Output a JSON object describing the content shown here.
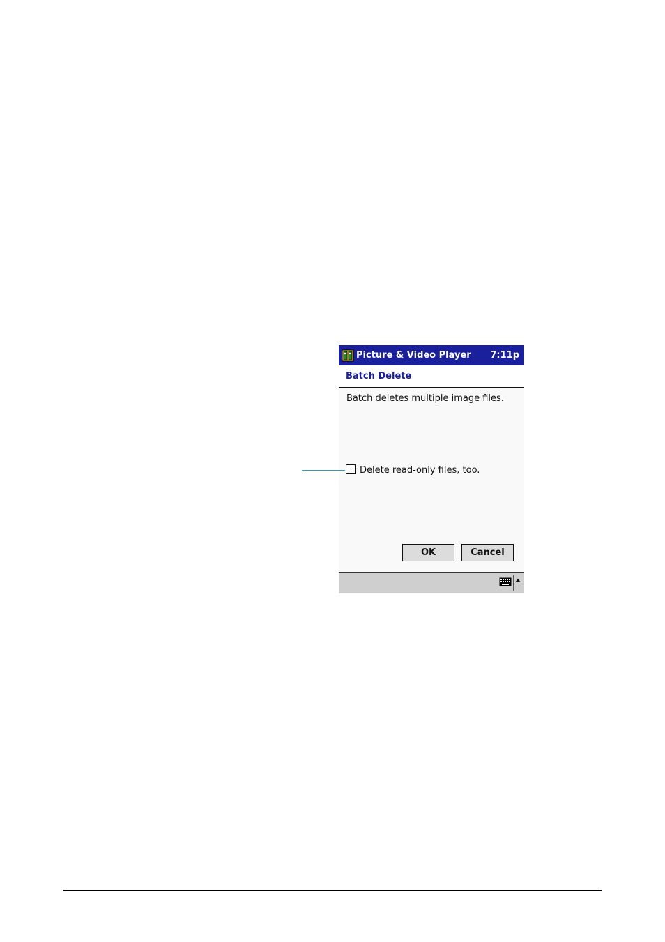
{
  "titlebar": {
    "title": "Picture & Video Player",
    "time": "7:11p",
    "icon": "app-icon"
  },
  "dialog": {
    "title": "Batch Delete",
    "description": "Batch deletes multiple image files.",
    "checkbox_label": "Delete read-only files, too.",
    "checkbox_checked": false
  },
  "buttons": {
    "ok": "OK",
    "cancel": "Cancel"
  },
  "bottombar": {
    "keyboard_icon": "keyboard-icon",
    "arrow_icon": "up-arrow-icon"
  },
  "colors": {
    "titlebar": "#1a1f9c",
    "dialog_title": "#1a1f9c",
    "callout": "#2a9ab8"
  }
}
